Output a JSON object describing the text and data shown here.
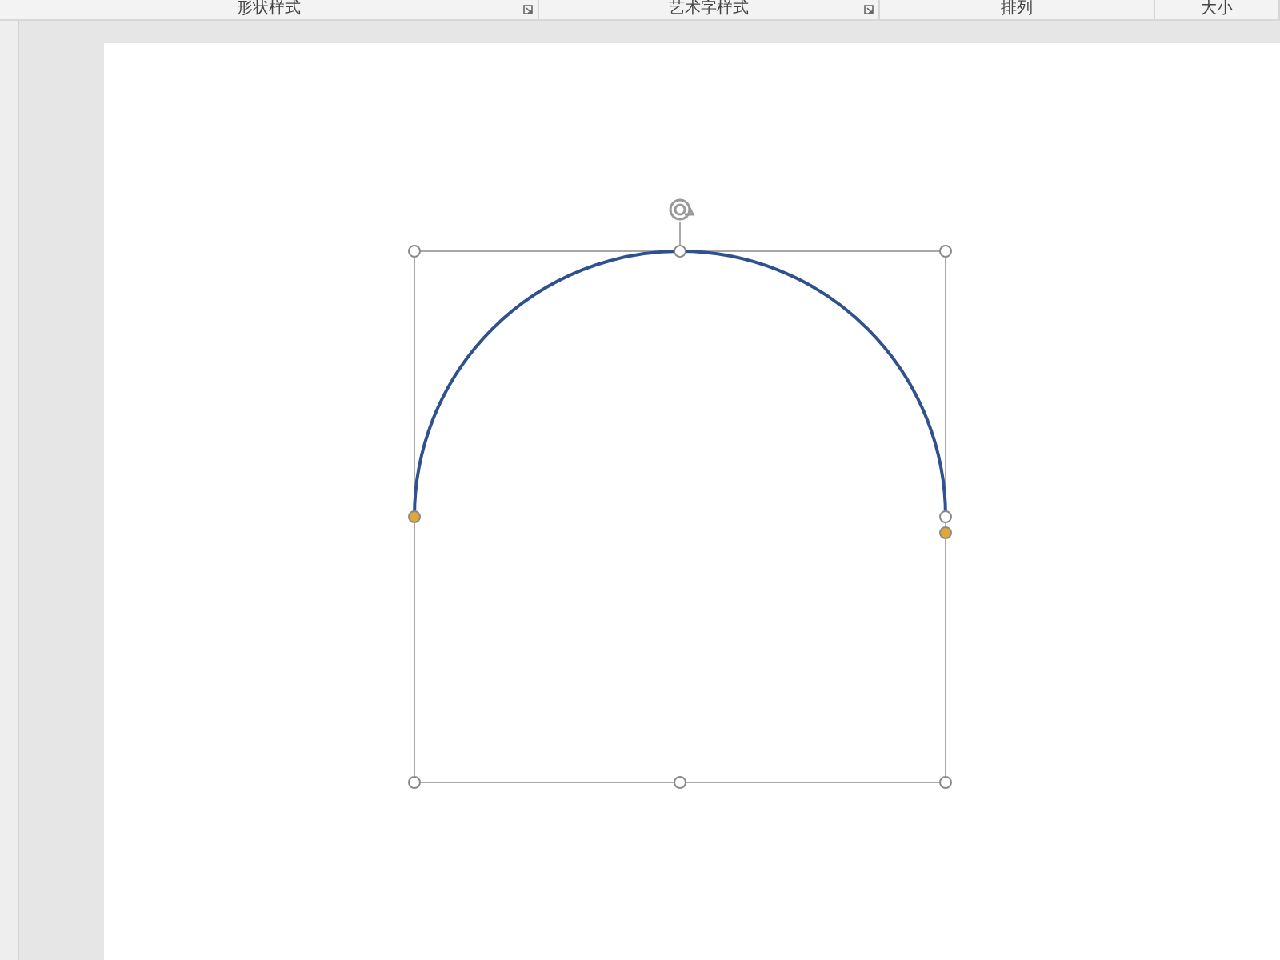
{
  "ribbon_groups": [
    {
      "label": "形状样式",
      "dialog_launcher": true
    },
    {
      "label": "艺术字样式",
      "dialog_launcher": true
    },
    {
      "label": "排列",
      "dialog_launcher": false
    },
    {
      "label": "大小",
      "dialog_launcher": false
    }
  ],
  "slide": {
    "shape": {
      "kind": "arc",
      "selected": true
    }
  }
}
